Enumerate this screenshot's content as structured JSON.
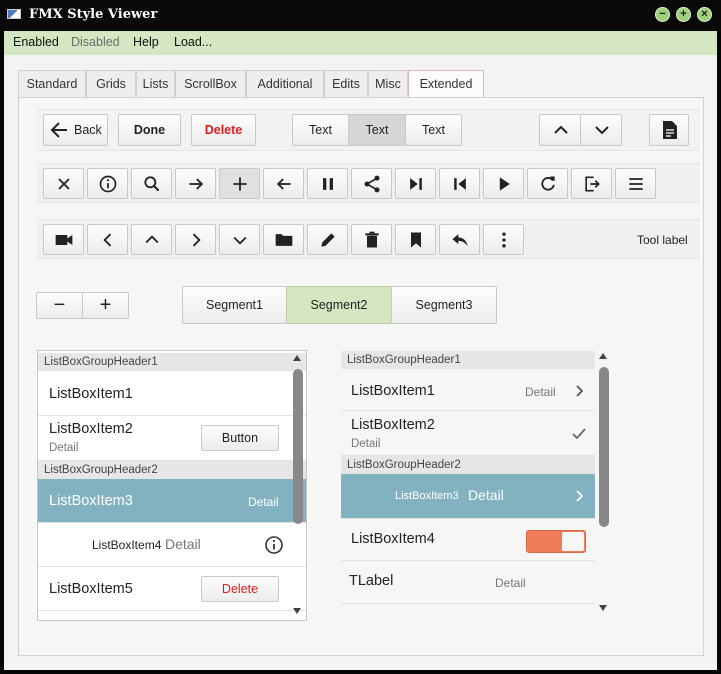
{
  "window": {
    "title": "FMX Style Viewer",
    "buttons": [
      "−",
      "+",
      "×"
    ]
  },
  "menu": [
    {
      "label": "Enabled",
      "disabled": false
    },
    {
      "label": "Disabled",
      "disabled": true
    },
    {
      "label": "Help",
      "disabled": false
    },
    {
      "label": "Load...",
      "disabled": false
    }
  ],
  "tabs": [
    "Standard",
    "Grids",
    "Lists",
    "ScrollBox",
    "Additional",
    "Edits",
    "Misc",
    "Extended"
  ],
  "active_tab": "Extended",
  "toolbar1": {
    "back": "Back",
    "done": "Done",
    "delete": "Delete",
    "segment": [
      "Text",
      "Text",
      "Text"
    ],
    "segment_selected": 1
  },
  "toolbar2_icons": [
    "close-icon",
    "info-icon",
    "search-icon",
    "arrow-right-icon",
    "plus-icon",
    "arrow-left-icon",
    "pause-icon",
    "share-icon",
    "skip-next-icon",
    "skip-previous-icon",
    "play-icon",
    "refresh-icon",
    "exit-icon",
    "menu-icon"
  ],
  "toolbar3_icons": [
    "camera-icon",
    "chevron-left-icon",
    "chevron-up-icon",
    "chevron-right-icon",
    "chevron-down-icon",
    "folder-icon",
    "pencil-icon",
    "trash-icon",
    "bookmark-icon",
    "reply-icon",
    "more-vertical-icon"
  ],
  "toolbar3_label": "Tool label",
  "stepper": {
    "minus": "−",
    "plus": "+"
  },
  "segments": [
    "Segment1",
    "Segment2",
    "Segment3"
  ],
  "segment_selected": 1,
  "listbox_left": {
    "header1": "ListBoxGroupHeader1",
    "item1": "ListBoxItem1",
    "item2": "ListBoxItem2",
    "item2_detail": "Detail",
    "item2_button": "Button",
    "header2": "ListBoxGroupHeader2",
    "item3": "ListBoxItem3",
    "item3_detail": "Detail",
    "item4": "ListBoxItem4",
    "item4_detail": "Detail",
    "item5": "ListBoxItem5",
    "item5_button": "Delete"
  },
  "listbox_right": {
    "header1": "ListBoxGroupHeader1",
    "item1": "ListBoxItem1",
    "item1_detail": "Detail",
    "item2": "ListBoxItem2",
    "item2_detail": "Detail",
    "header2": "ListBoxGroupHeader2",
    "item3": "ListBoxItem3",
    "item3_detail": "Detail",
    "item4": "ListBoxItem4",
    "item4_switch_on": true,
    "label": "TLabel",
    "label_detail": "Detail"
  },
  "colors": {
    "accent_green": "#d4e7c2",
    "selection": "#82b2c0",
    "switch_on": "#f07c5a",
    "delete_red": "#e01c1c"
  }
}
